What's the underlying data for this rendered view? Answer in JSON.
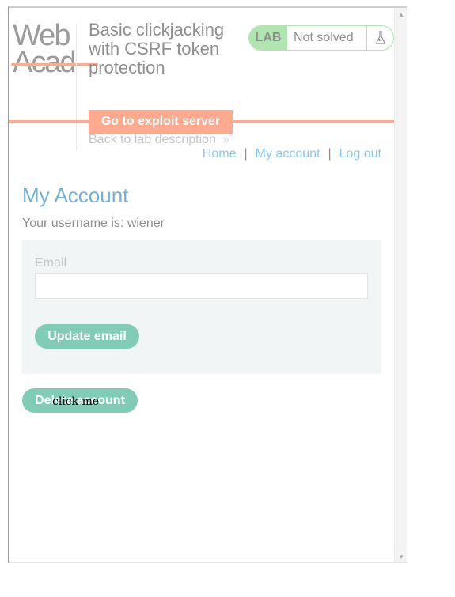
{
  "logo": {
    "line1": "Web S",
    "line2": "Acade"
  },
  "lab": {
    "title": "Basic clickjacking with CSRF token protection",
    "badge": "LAB",
    "status": "Not solved",
    "exploit_button": "Go to exploit server",
    "back_link": "Back to lab description"
  },
  "nav": {
    "home": "Home",
    "sep1": "|",
    "my_account": "My account",
    "sep2": "|",
    "log_out": "Log out"
  },
  "account": {
    "heading": "My Account",
    "username_line": "Your username is: wiener",
    "email_label": "Email",
    "email_value": "",
    "update_button": "Update email",
    "delete_button": "Delete account"
  },
  "decoy": {
    "text": "click me"
  },
  "colors": {
    "brand_orange": "#ff6633",
    "lab_green": "#70d070",
    "button_green": "#1ca37e",
    "link_blue": "#2aa0d8"
  },
  "iframe_opacity": 0.55
}
